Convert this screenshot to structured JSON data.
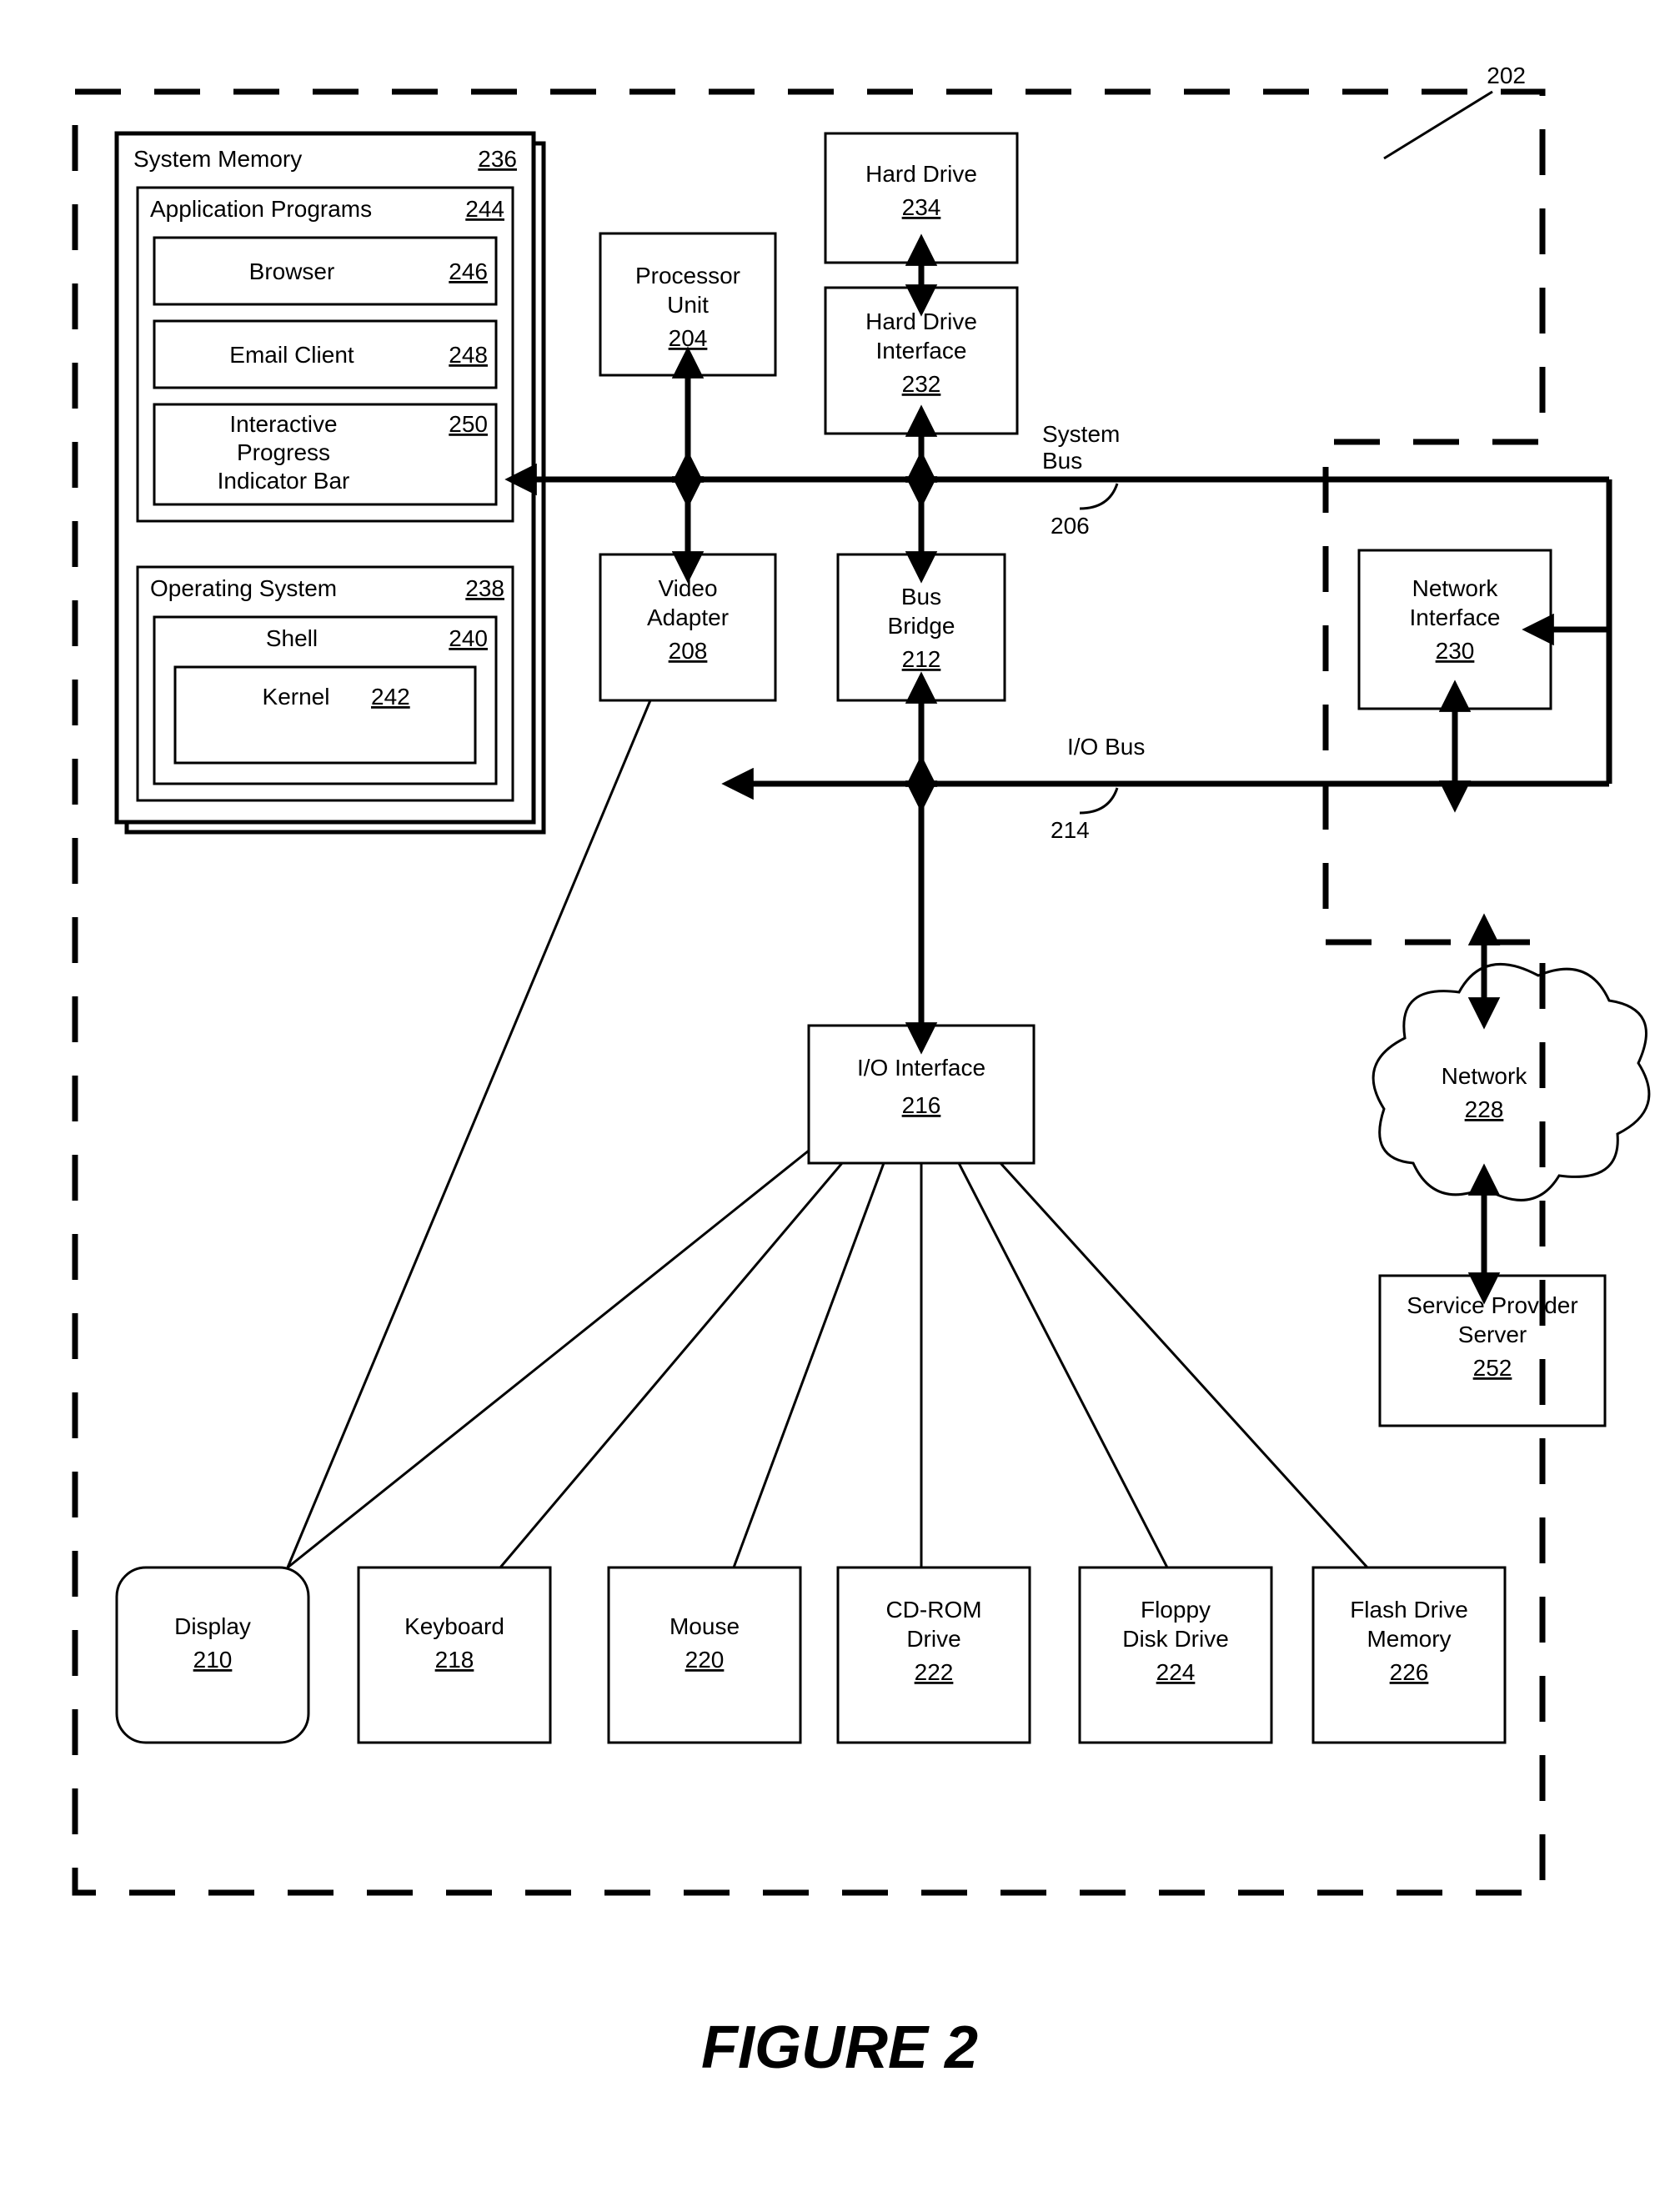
{
  "figure_label": "FIGURE 2",
  "ref": {
    "client": "202",
    "processor": {
      "label": "Processor Unit",
      "num": "204"
    },
    "sysbus": {
      "label": "System Bus",
      "num": "206"
    },
    "video": {
      "label": "Video Adapter",
      "num": "208"
    },
    "display": {
      "label": "Display",
      "num": "210"
    },
    "busbridge": {
      "label": "Bus Bridge",
      "num": "212"
    },
    "iobus": {
      "label": "I/O Bus",
      "num": "214"
    },
    "ioif": {
      "label": "I/O Interface",
      "num": "216"
    },
    "keyboard": {
      "label": "Keyboard",
      "num": "218"
    },
    "mouse": {
      "label": "Mouse",
      "num": "220"
    },
    "cdrom": {
      "label": "CD-ROM Drive",
      "num": "222"
    },
    "floppy": {
      "label": "Floppy Disk Drive",
      "num": "224"
    },
    "flash": {
      "label": "Flash Drive Memory",
      "num": "226"
    },
    "network": {
      "label": "Network",
      "num": "228"
    },
    "netif": {
      "label": "Network Interface",
      "num": "230"
    },
    "hdif": {
      "label": "Hard Drive Interface",
      "num": "232"
    },
    "hd": {
      "label": "Hard Drive",
      "num": "234"
    },
    "sysmem": {
      "label": "System Memory",
      "num": "236"
    },
    "os": {
      "label": "Operating System",
      "num": "238"
    },
    "shell": {
      "label": "Shell",
      "num": "240"
    },
    "kernel": {
      "label": "Kernel",
      "num": "242"
    },
    "apps": {
      "label": "Application Programs",
      "num": "244"
    },
    "browser": {
      "label": "Browser",
      "num": "246"
    },
    "email": {
      "label": "Email Client",
      "num": "248"
    },
    "ipi": {
      "label1": "Interactive",
      "label2": "Progress",
      "label3": "Indicator Bar",
      "num": "250"
    },
    "sps": {
      "label1": "Service Provider",
      "label2": "Server",
      "num": "252"
    }
  }
}
